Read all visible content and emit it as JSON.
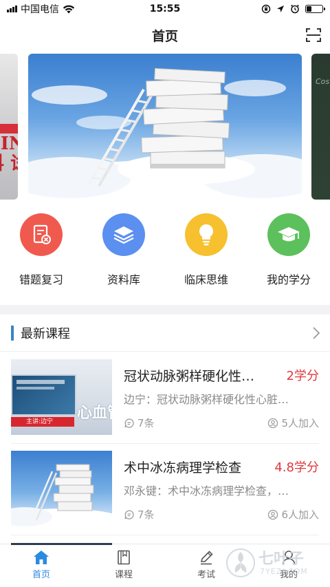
{
  "status_bar": {
    "carrier": "中国电信",
    "time": "15:55"
  },
  "nav": {
    "title": "首页"
  },
  "banner": {
    "left_slide_text": "CINE 科 试",
    "right_slide_text": "Cos Rela"
  },
  "quick_menu": [
    {
      "label": "错题复习",
      "icon": "error-review-icon",
      "color": "#f05a4e"
    },
    {
      "label": "资料库",
      "icon": "layers-icon",
      "color": "#5b8ff0"
    },
    {
      "label": "临床思维",
      "icon": "lightbulb-icon",
      "color": "#f6c02e"
    },
    {
      "label": "我的学分",
      "icon": "graduation-cap-icon",
      "color": "#5cc05c"
    }
  ],
  "section": {
    "title": "最新课程"
  },
  "courses": [
    {
      "title": "冠状动脉粥样硬化性…",
      "credit": "2学分",
      "desc": "边宁：冠状动脉粥样硬化性心脏…",
      "comments": "7条",
      "joined": "5人加入",
      "thumb_caption": "主讲:边宁",
      "thumb_text": "心血管"
    },
    {
      "title": "术中冰冻病理学检查",
      "credit": "4.8学分",
      "desc": "邓永键：术中冰冻病理学检查，…",
      "comments": "7条",
      "joined": "6人加入"
    }
  ],
  "tabs": [
    {
      "label": "首页",
      "icon": "home-icon",
      "active": true
    },
    {
      "label": "课程",
      "icon": "book-icon",
      "active": false
    },
    {
      "label": "考试",
      "icon": "pen-icon",
      "active": false
    },
    {
      "label": "我的",
      "icon": "user-icon",
      "active": false
    }
  ],
  "watermark": {
    "text": "七叶子",
    "subtext": "7YEZI.COM"
  },
  "colors": {
    "accent": "#2b8ae0",
    "credit": "#e0373b",
    "section_bar": "#3a83c6"
  }
}
